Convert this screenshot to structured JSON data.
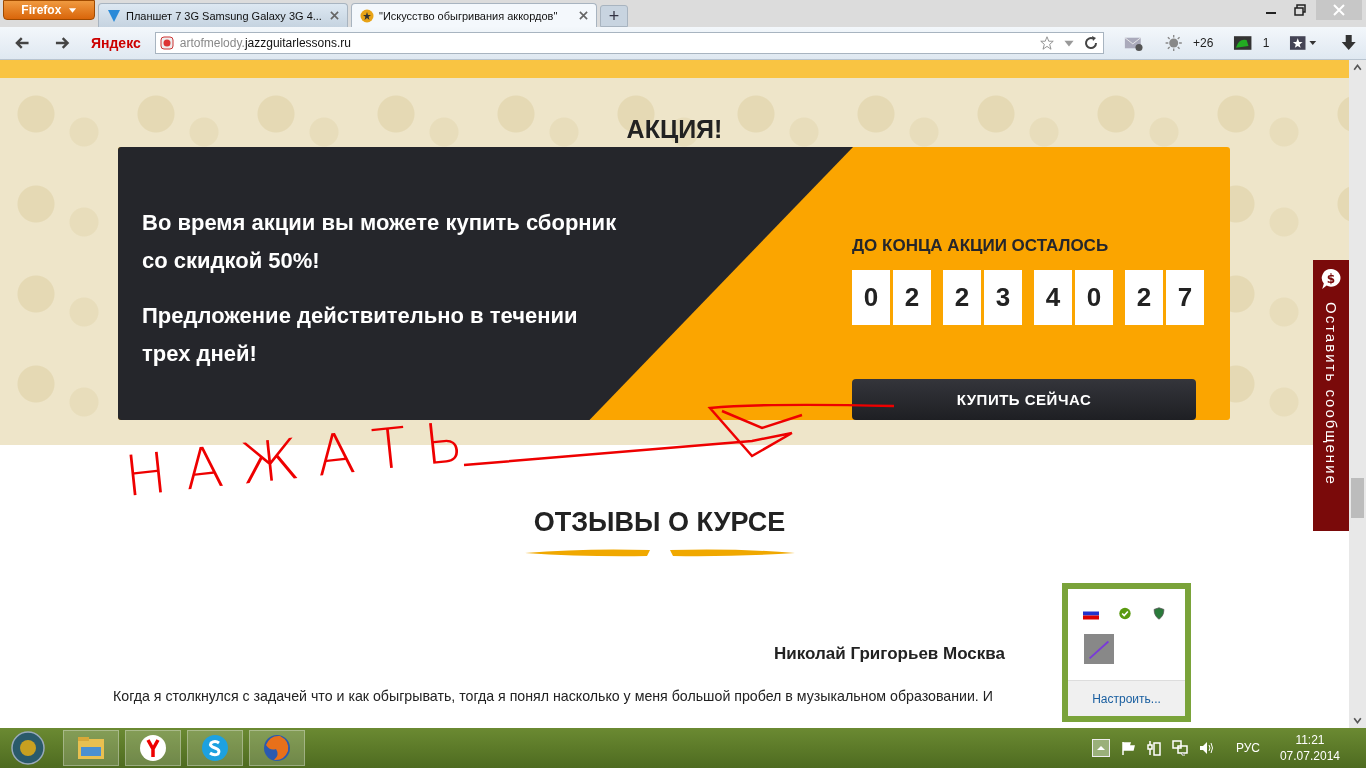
{
  "browser": {
    "menu_button": "Firefox",
    "tabs": [
      {
        "title": "Планшет 7 3G Samsung Galaxy 3G 4...",
        "selected": false
      },
      {
        "title": "\"Искусство обыгривания аккордов\"",
        "selected": true
      }
    ],
    "new_tab": "+",
    "search_brand": "Яндекс",
    "url_subdomain": "artofmelody.",
    "url_domain": "jazzguitarlessons.ru",
    "weather": "+26",
    "notifications": "1"
  },
  "promo": {
    "title": "АКЦИЯ!",
    "lines": [
      "Во время акции вы можете купить сборник со скидкой 50%!",
      "Предложение действительно в течении трех дней!"
    ],
    "countdown_label": "ДО КОНЦА АКЦИИ ОСТАЛОСЬ",
    "digits": [
      "0",
      "2",
      "2",
      "3",
      "4",
      "0",
      "2",
      "7"
    ],
    "buy_button": "КУПИТЬ СЕЙЧАС"
  },
  "annotation": "НАЖАТЬ",
  "reviews": {
    "title": "ОТЗЫВЫ О КУРСЕ",
    "author": "Николай Григорьев Москва",
    "text": "Когда я столкнулся с задачей что и как обыгрывать, тогда я понял насколько у меня большой пробел в музыкальном образовании. И"
  },
  "side_tab": "Оставить сообщение",
  "side_tab_icon": "$",
  "tray_popup": {
    "link": "Настроить..."
  },
  "taskbar": {
    "language": "РУС",
    "time": "11:21",
    "date": "07.07.2014"
  }
}
